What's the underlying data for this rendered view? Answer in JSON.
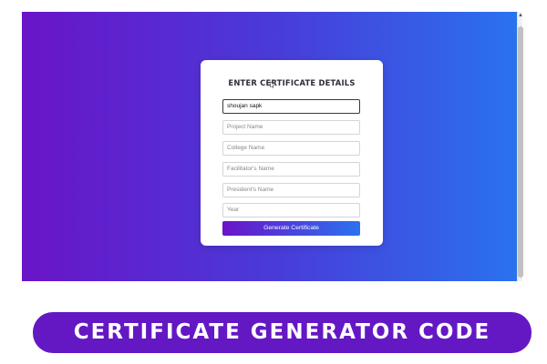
{
  "form": {
    "title": "ENTER CERTIFICATE DETAILS",
    "fields": [
      {
        "value": "shoujan sapk",
        "placeholder": ""
      },
      {
        "value": "",
        "placeholder": "Project Name"
      },
      {
        "value": "",
        "placeholder": "College Name"
      },
      {
        "value": "",
        "placeholder": "Facilitator's Name"
      },
      {
        "value": "",
        "placeholder": "President's Name"
      },
      {
        "value": "",
        "placeholder": "Year"
      }
    ],
    "button_label": "Generate Certificate"
  },
  "banner": {
    "text": "CERTIFICATE GENERATOR CODE"
  },
  "colors": {
    "gradient_start": "#6a14c8",
    "gradient_end": "#2a72ef",
    "banner": "#6418c4"
  },
  "icons": {
    "cursor": "mouse-pointer-icon",
    "scroll": "scroll-up-arrow-icon"
  }
}
